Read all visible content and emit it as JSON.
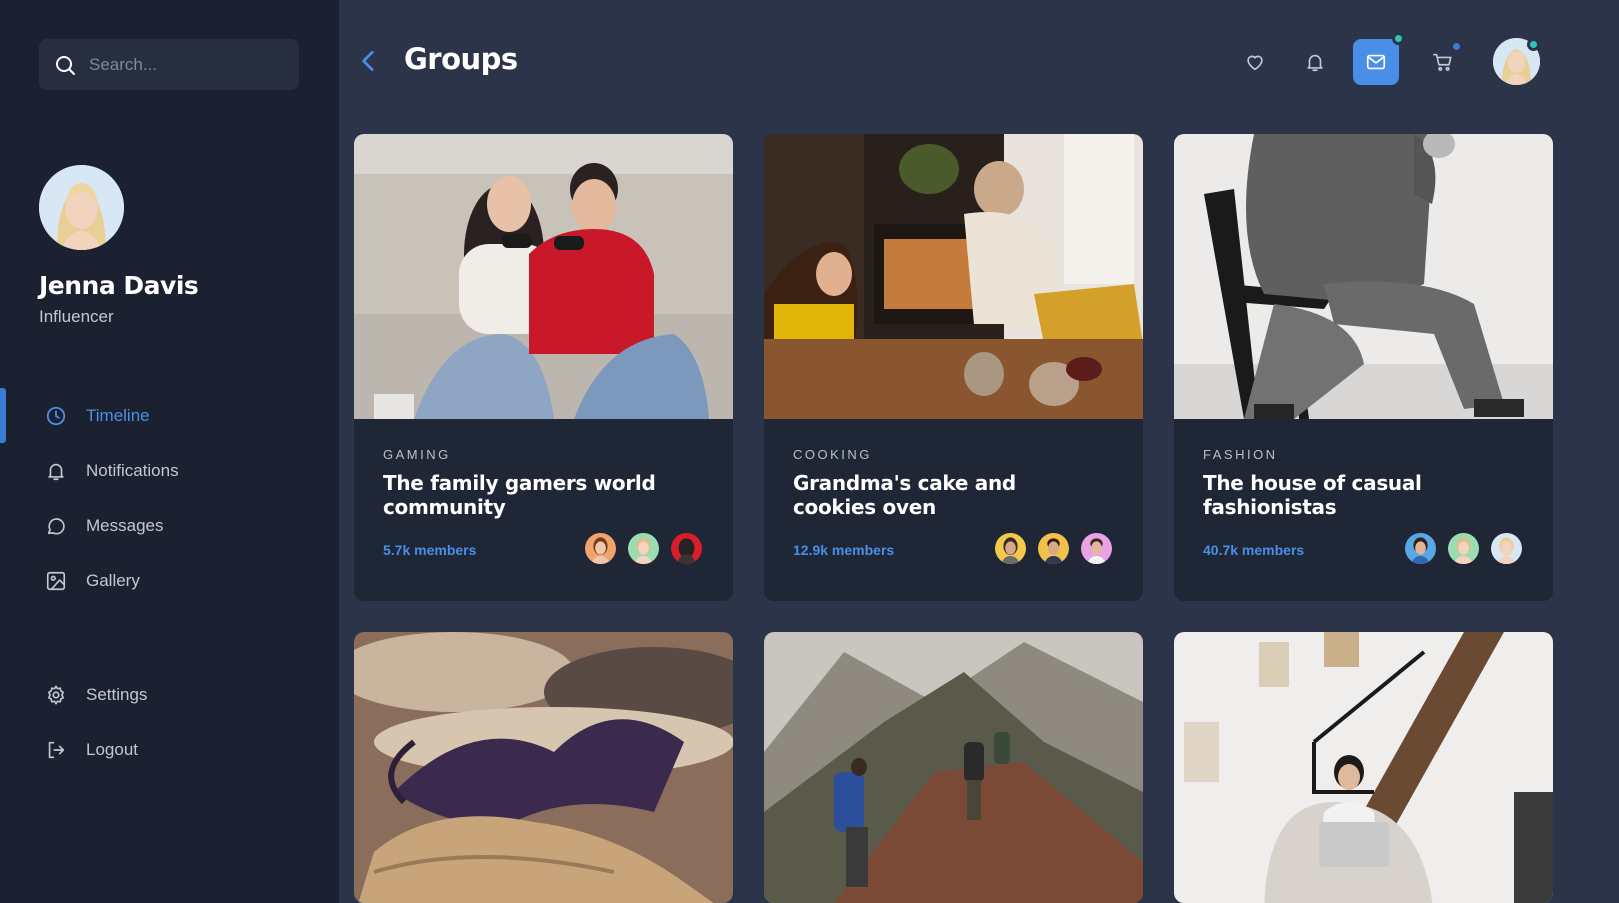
{
  "search": {
    "placeholder": "Search..."
  },
  "profile": {
    "name": "Jenna Davis",
    "role": "Influencer"
  },
  "nav": [
    {
      "label": "Timeline",
      "icon": "clock-icon",
      "active": true
    },
    {
      "label": "Notifications",
      "icon": "bell-icon"
    },
    {
      "label": "Messages",
      "icon": "chat-bubble-icon"
    },
    {
      "label": "Gallery",
      "icon": "image-icon"
    }
  ],
  "nav_bottom": [
    {
      "label": "Settings",
      "icon": "gear-icon"
    },
    {
      "label": "Logout",
      "icon": "logout-icon"
    }
  ],
  "header": {
    "title": "Groups",
    "icons": [
      "heart-icon",
      "bell-icon",
      "mail-icon",
      "cart-icon"
    ]
  },
  "colors": {
    "accent": "#4a8fe7",
    "sidebar": "#1b2130",
    "main": "#2b3448",
    "card": "#1f2636",
    "online": "#2ec4b6"
  },
  "groups": [
    {
      "category": "GAMING",
      "title": "The family gamers world community",
      "members": "5.7k members"
    },
    {
      "category": "COOKING",
      "title": "Grandma's cake and cookies oven",
      "members": "12.9k members"
    },
    {
      "category": "FASHION",
      "title": "The house of casual fashionistas",
      "members": "40.7k members"
    },
    {
      "category": "",
      "title": "",
      "members": ""
    },
    {
      "category": "",
      "title": "",
      "members": ""
    },
    {
      "category": "",
      "title": "",
      "members": ""
    }
  ]
}
